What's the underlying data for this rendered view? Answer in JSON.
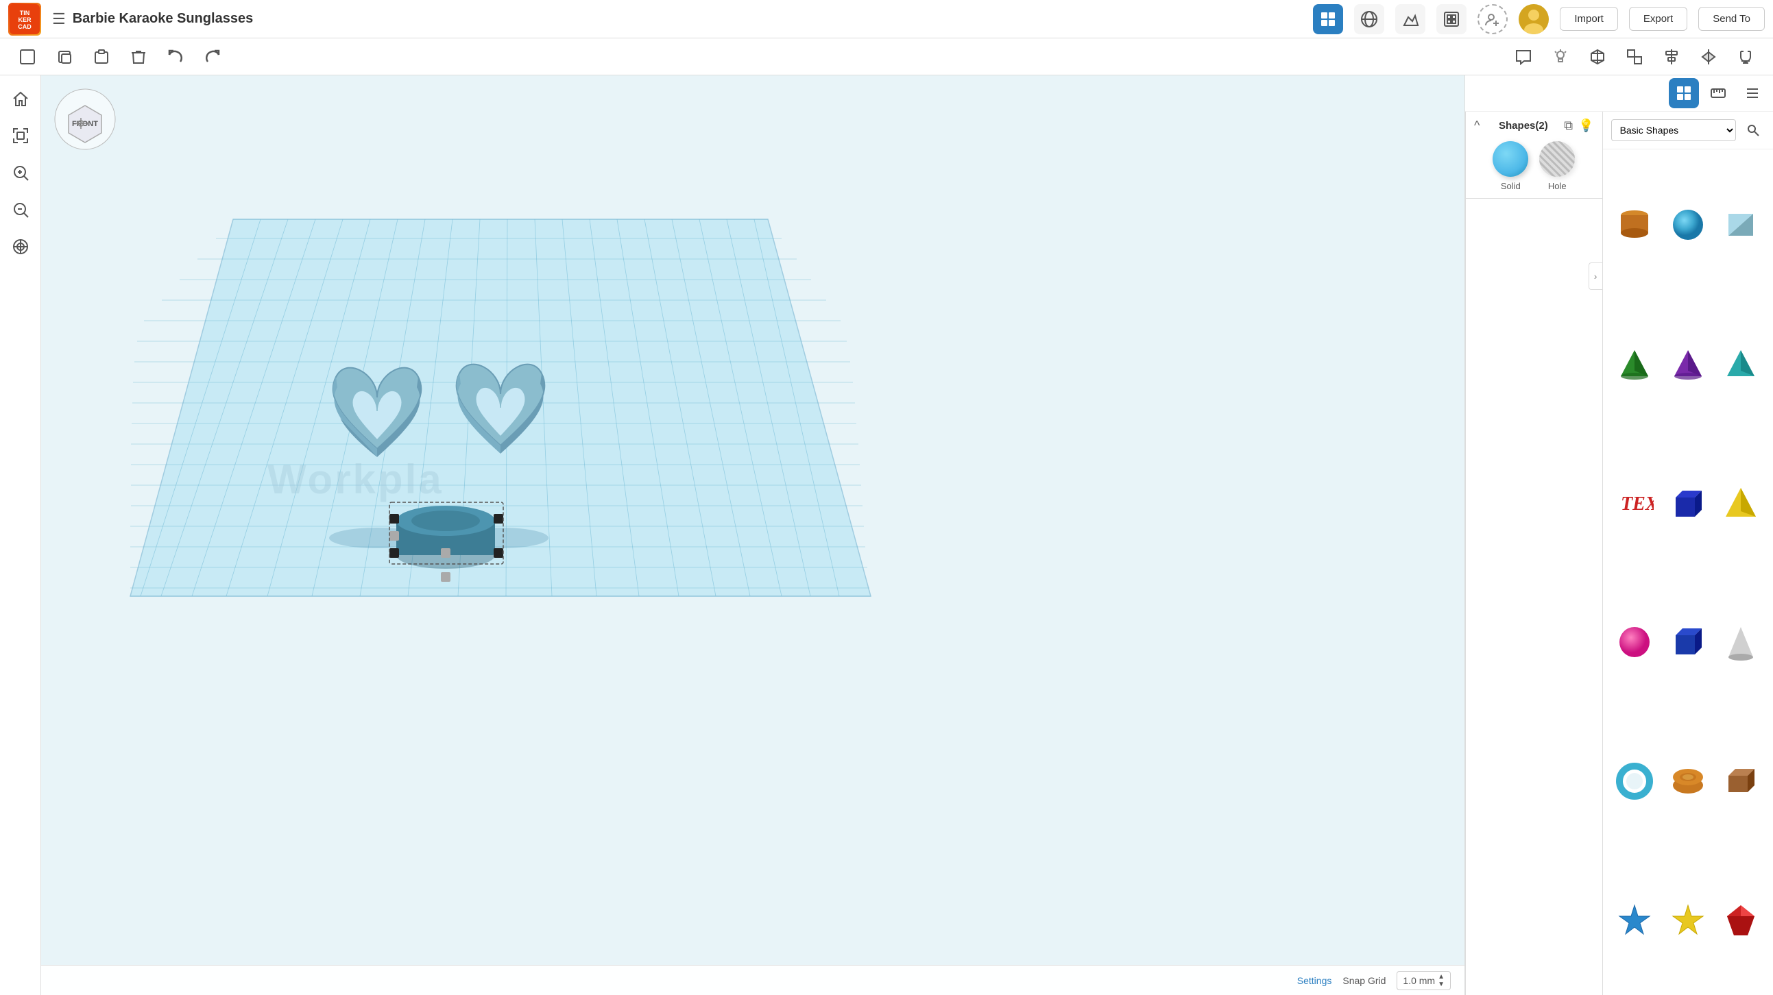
{
  "app": {
    "logo_text": "TIN\nCAD",
    "title": "Barbie Karaoke Sunglasses"
  },
  "topbar": {
    "menu_icon": "☰",
    "import_label": "Import",
    "export_label": "Export",
    "send_to_label": "Send To"
  },
  "toolbar": {
    "tools": [
      {
        "name": "new",
        "icon": "⬜",
        "label": "New"
      },
      {
        "name": "copy",
        "icon": "⧉",
        "label": "Copy"
      },
      {
        "name": "paste",
        "icon": "📋",
        "label": "Paste"
      },
      {
        "name": "delete",
        "icon": "🗑",
        "label": "Delete"
      },
      {
        "name": "undo",
        "icon": "↩",
        "label": "Undo"
      },
      {
        "name": "redo",
        "icon": "↪",
        "label": "Redo"
      }
    ],
    "right_tools": [
      {
        "name": "comment",
        "icon": "💬"
      },
      {
        "name": "light",
        "icon": "💡"
      },
      {
        "name": "annotate",
        "icon": "🔖"
      },
      {
        "name": "view3d",
        "icon": "⬡"
      },
      {
        "name": "align",
        "icon": "⊞"
      },
      {
        "name": "mirror",
        "icon": "⇔"
      },
      {
        "name": "magnet",
        "icon": "🧲"
      }
    ]
  },
  "left_sidebar": {
    "tools": [
      {
        "name": "home",
        "icon": "⌂"
      },
      {
        "name": "fit",
        "icon": "⤢"
      },
      {
        "name": "zoom-in",
        "icon": "+"
      },
      {
        "name": "zoom-out",
        "icon": "−"
      },
      {
        "name": "shapes",
        "icon": "✦"
      }
    ]
  },
  "shapes_inspector": {
    "title": "Shapes(2)",
    "solid_label": "Solid",
    "hole_label": "Hole"
  },
  "shapes_panel": {
    "category": "Basic Shapes",
    "search_placeholder": "Search shapes"
  },
  "bottom_bar": {
    "settings_label": "Settings",
    "snap_grid_label": "Snap Grid",
    "snap_grid_value": "1.0 mm"
  },
  "canvas": {
    "watermark": "Workpla"
  },
  "view_cube": {
    "label": "FRONT"
  }
}
